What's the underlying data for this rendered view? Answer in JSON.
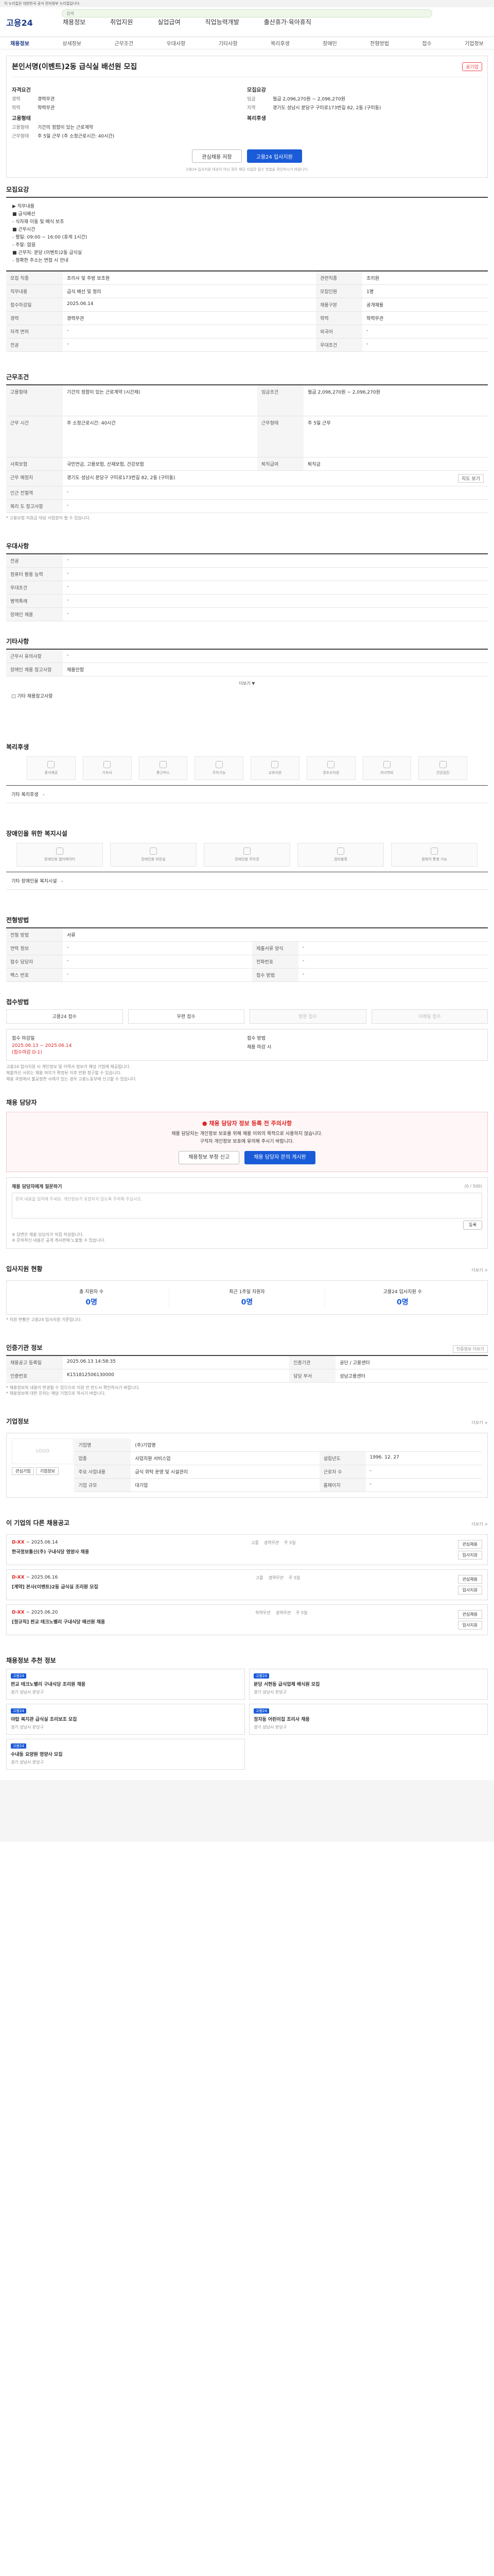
{
  "gov_bar": "이 누리집은 대한민국 공식 전자정부 누리집입니다.",
  "header": {
    "logo": "고용24",
    "search_placeholder": "검색",
    "gnb": [
      "채용정보",
      "취업지원",
      "실업급여",
      "직업능력개발",
      "출산휴가·육아휴직"
    ]
  },
  "subnav": [
    "채용정보",
    "상세정보",
    "근무조건",
    "우대사항",
    "기타사항",
    "복리후생",
    "장애인",
    "전형방법",
    "접수",
    "기업정보"
  ],
  "job": {
    "badge": "공기업",
    "title": "본인서명(이벤트)2동 급식실 배선원 모집",
    "left_heading": "자격요건",
    "left_rows": [
      {
        "k": "경력",
        "v": "경력무관"
      },
      {
        "k": "학력",
        "v": "학력무관"
      }
    ],
    "left_heading2": "고용형태",
    "left_rows2": [
      {
        "k": "고용형태",
        "v": "기간의 정함이 있는 근로계약"
      },
      {
        "k": "근무형태",
        "v": "주 5일 근무 (주 소정근로시간: 40시간)"
      }
    ],
    "right_heading": "모집요강",
    "right_rows": [
      {
        "k": "임금",
        "v": "월급 2,096,270원 ~ 2,096,270원"
      },
      {
        "k": "지역",
        "v": "경기도 성남시 분당구 구미로173번길 82, 2동 (구미동)"
      }
    ],
    "right_heading2": "복리후생",
    "btn_save": "관심채용 저장",
    "btn_apply": "고용24 입사지원",
    "notice": "고용24 입사지원 대상이 아닌 경우 해당 사업장 접수 방법을 확인하시기 바랍니다."
  },
  "sec_detail": {
    "title": "모집요강",
    "desc": [
      "▶ 직무내용",
      "■ 급식배선",
      "- 식자재 이동 및 배식 보조",
      "■ 근무시간",
      "- 평일: 09:00 ~ 16:00 (휴게 1시간)",
      "- 주말: 없음",
      "■ 근무지: 분당 (이벤트)2동 급식실",
      "- 정확한 주소는 면접 시 안내"
    ],
    "rows": [
      {
        "k": "모집 직종",
        "v": "조리사 및 주방 보조원",
        "k2": "관련직종",
        "v2": "조리원"
      },
      {
        "k": "직무내용",
        "v": "급식 배선 및 정리",
        "k2": "모집인원",
        "v2": "1명"
      },
      {
        "k": "접수마감일",
        "v": "2025.06.14",
        "k2": "채용구분",
        "v2": "공개채용"
      },
      {
        "k": "경력",
        "v": "경력무관",
        "k2": "학력",
        "v2": "학력무관"
      },
      {
        "k": "자격 면허",
        "v": "-",
        "k2": "외국어",
        "v2": "-"
      },
      {
        "k": "전공",
        "v": "-",
        "k2": "우대조건",
        "v2": "-"
      }
    ]
  },
  "sec_work": {
    "title": "근무조건",
    "rows": [
      {
        "k": "고용형태",
        "v": "기간의 정함이 있는 근로계약 (시간제)",
        "k2": "임금조건",
        "v2": "월급 2,096,270원 ~ 2,096,270원"
      },
      {
        "k": "근무 시간",
        "v": "주 소정근로시간: 40시간",
        "k2": "근무형태",
        "v2": "주 5일 근무"
      },
      {
        "k": "사회보험",
        "v": "국민연금, 고용보험, 산재보험, 건강보험",
        "k2": "퇴직급여",
        "v2": "퇴직금"
      },
      {
        "k": "근무 예정지",
        "v": "경기도 성남시 분당구 구미로173번길 82, 2동 (구미동)",
        "k2": "",
        "v2": ""
      },
      {
        "k": "인근 전철역",
        "v": "-",
        "k2": "",
        "v2": ""
      },
      {
        "k": "복리 도 참고사항",
        "v": "-",
        "k2": "",
        "v2": ""
      }
    ],
    "map_btn": "지도 보기",
    "note": "* 고용보험 지원금 대상 사업장이 될 수 있습니다."
  },
  "sec_pref": {
    "title": "우대사항",
    "rows": [
      {
        "k": "전공",
        "v": "-"
      },
      {
        "k": "컴퓨터 활용 능력",
        "v": "-"
      },
      {
        "k": "우대조건",
        "v": "-"
      },
      {
        "k": "병역특례",
        "v": "-"
      },
      {
        "k": "장애인 채용",
        "v": "-"
      }
    ]
  },
  "sec_etc": {
    "title": "기타사항",
    "rows": [
      {
        "k": "근무시 유의사항",
        "v": "-"
      },
      {
        "k": "장애인 채용 참고사항",
        "v": "채용안함"
      }
    ],
    "more": "더보기 ▼",
    "extra": "□ 기타 채용참고사항"
  },
  "sec_welfare": {
    "title": "복리후생",
    "items": [
      "중식제공",
      "기숙사",
      "통근버스",
      "주차가능",
      "교육지원",
      "경조사지원",
      "자녀학비",
      "건강검진"
    ],
    "note_label": "기타 복리후생",
    "note_val": "-"
  },
  "sec_disabled": {
    "title": "장애인을 위한 복지시설",
    "items": [
      "장애인용 엘리베이터",
      "장애인용 화장실",
      "장애인용 주차장",
      "점자블록",
      "휠체어 통행 가능"
    ],
    "note_label": "기타 장애인을 복지시설",
    "note_val": "-"
  },
  "sec_select": {
    "title": "전형방법",
    "rows": [
      {
        "k": "전형 방법",
        "v": "서류",
        "k2": "",
        "v2": ""
      },
      {
        "k": "연락 정보",
        "v": "-",
        "k2": "제출서류 양식",
        "v2": "-"
      },
      {
        "k": "접수 담당자",
        "v": "-",
        "k2": "전화번호",
        "v2": "-"
      },
      {
        "k": "팩스 번호",
        "v": "-",
        "k2": "접수 방법",
        "v2": "-"
      }
    ]
  },
  "sec_apply": {
    "title": "접수방법",
    "methods": [
      "고용24 접수",
      "우편 접수",
      "방문 접수",
      "이메일 접수"
    ],
    "method_enabled": [
      true,
      true,
      false,
      false
    ],
    "period_label": "접수 마감일",
    "period_val": "2025.06.13 ~ 2025.06.14",
    "period_dday": "(접수마감 D-1)",
    "docs_label": "접수 방법",
    "docs_val": "채용 마감 시",
    "notes": [
      "고용24 입사지원 시 개인정보 및 이력서 정보가 해당 기업에 제공됩니다.",
      "제출하신 서류는 채용 여부가 확정된 이후 반환 청구할 수 있습니다.",
      "채용 과정에서 불공정한 사례가 있는 경우 고용노동부에 신고할 수 있습니다."
    ]
  },
  "sec_alert": {
    "title": "채용 담당자",
    "alert_title": "● 채용 담당자 정보 등록 전 주의사항",
    "alert_text1": "채용 담당자는 개인정보 보호를 위해 채용 이외의 목적으로 사용하지 않습니다.",
    "alert_text2": "구직자 개인정보 보호에 유의해 주시기 바랍니다.",
    "btn_report": "채용정보 부정 신고",
    "btn_qna": "채용 담당자 문의 게시판"
  },
  "sec_qa": {
    "title": "채용 담당자에게 질문하기",
    "count": "(0 / 500)",
    "placeholder": "문의 내용을 입력해 주세요. 개인정보가 포함되지 않도록 주의해 주십시오.",
    "btn": "등록",
    "notes": [
      "※ 답변은 채용 담당자가 직접 작성합니다.",
      "※ 문의하신 내용은 공개 게시판에 노출될 수 있습니다."
    ]
  },
  "sec_stats": {
    "title": "입사지원 현황",
    "more": "더보기 >",
    "items": [
      {
        "label": "총 지원자 수",
        "val": "0명"
      },
      {
        "label": "최근 1주일 지원자",
        "val": "0명"
      },
      {
        "label": "고용24 입사지원 수",
        "val": "0명"
      }
    ],
    "note": "* 지원 현황은 고용24 입사지원 기준입니다."
  },
  "sec_manage": {
    "title": "인증기관 정보",
    "more": "인증정보 더보기",
    "rows": [
      {
        "k": "채용공고 등록일",
        "v": "2025.06.13 14:58:35",
        "k2": "인증기관",
        "v2": "공단 / 고용센터"
      },
      {
        "k": "인증번호",
        "v": "K151812506130000",
        "k2": "담당 부서",
        "v2": "성남고용센터"
      }
    ],
    "notes": [
      "* 채용정보의 내용이 변경될 수 있으므로 지원 전 반드시 확인하시기 바랍니다.",
      "* 채용정보에 대한 문의는 해당 기업으로 하시기 바랍니다."
    ]
  },
  "sec_company": {
    "title": "기업정보",
    "more": "더보기 >",
    "logo_alt": "LOGO",
    "btn1": "관심기업",
    "btn2": "기업정보",
    "name_k": "기업명",
    "name_v": "(주)기업명",
    "rows": [
      {
        "k": "업종",
        "v": "사업지원 서비스업",
        "k2": "설립년도",
        "v2": "1996. 12. 27"
      },
      {
        "k": "주요 사업내용",
        "v": "급식 위탁 운영 및 시설관리",
        "k2": "근로자 수",
        "v2": "-"
      },
      {
        "k": "기업 규모",
        "v": "대기업",
        "k2": "홈페이지",
        "v2": "-"
      }
    ]
  },
  "sec_similar": {
    "title": "이 기업의 다른 채용공고",
    "more": "더보기 >",
    "jobs": [
      {
        "dday": "D-XX",
        "date": "~ 2025.06.14",
        "title": "한국정보통신(주) 구내식당 영양사 채용",
        "tags": [
          "고졸",
          "경력무관",
          "주 5일"
        ],
        "btn1": "관심채용",
        "btn2": "입사지원"
      },
      {
        "dday": "D-XX",
        "date": "~ 2025.06.16",
        "title": "[계약] 본사(이벤트)2동 급식실 조리원 모집",
        "tags": [
          "고졸",
          "경력무관",
          "주 5일"
        ],
        "btn1": "관심채용",
        "btn2": "입사지원"
      },
      {
        "dday": "D-XX",
        "date": "~ 2025.06.20",
        "title": "[정규직] 판교 테크노밸리 구내식당 배선원 채용",
        "tags": [
          "학력무관",
          "경력무관",
          "주 5일"
        ],
        "btn1": "관심채용",
        "btn2": "입사지원"
      }
    ]
  },
  "sec_recommend": {
    "title": "채용정보 추천 정보",
    "items": [
      {
        "tag": "고용24",
        "title": "판교 테크노밸리 구내식당 조리원 채용",
        "sub": "경기 성남시 분당구"
      },
      {
        "tag": "고용24",
        "title": "분당 서현동 급식업체 배식원 모집",
        "sub": "경기 성남시 분당구"
      },
      {
        "tag": "고용24",
        "title": "야탑 복지관 급식실 조리보조 모집",
        "sub": "경기 성남시 분당구"
      },
      {
        "tag": "고용24",
        "title": "정자동 어린이집 조리사 채용",
        "sub": "경기 성남시 분당구"
      },
      {
        "tag": "고용24",
        "title": "수내동 요양원 영양사 모집",
        "sub": "경기 성남시 분당구"
      }
    ]
  }
}
